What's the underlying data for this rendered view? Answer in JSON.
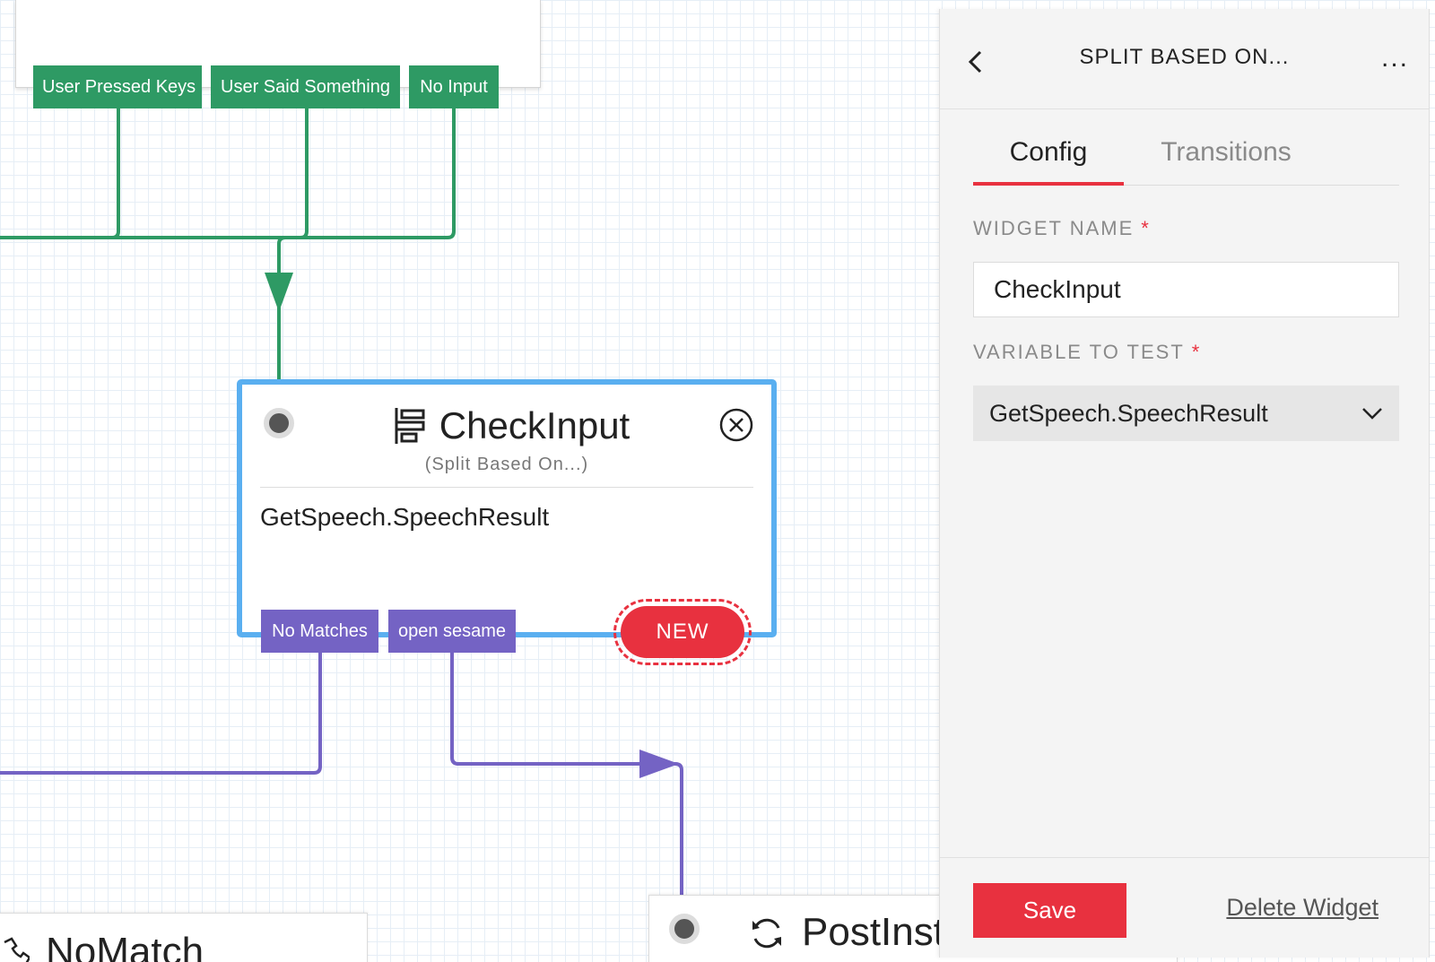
{
  "canvas": {
    "top_widget": {
      "transitions": [
        "User Pressed Keys",
        "User Said Something",
        "No Input"
      ]
    },
    "widget": {
      "title": "CheckInput",
      "subtitle": "(Split Based On...)",
      "value": "GetSpeech.SpeechResult",
      "transitions": [
        "No Matches",
        "open sesame"
      ],
      "new_label": "NEW",
      "icon": "split-icon"
    },
    "bottom_left": {
      "title": "NoMatch",
      "icon": "phone-hangup-icon"
    },
    "bottom_right": {
      "title": "PostInst",
      "icon": "refresh-icon"
    }
  },
  "panel": {
    "title": "SPLIT BASED ON...",
    "more": "...",
    "tabs": [
      {
        "label": "Config",
        "active": true
      },
      {
        "label": "Transitions",
        "active": false
      }
    ],
    "widget_name": {
      "label": "WIDGET NAME",
      "required": "*",
      "value": "CheckInput"
    },
    "variable": {
      "label": "VARIABLE TO TEST",
      "required": "*",
      "value": "GetSpeech.SpeechResult"
    },
    "save_label": "Save",
    "delete_label": "Delete Widget"
  },
  "colors": {
    "green": "#2e9a64",
    "purple": "#7463c4",
    "selected_border": "#5aaff0",
    "accent_red": "#e8313f"
  }
}
